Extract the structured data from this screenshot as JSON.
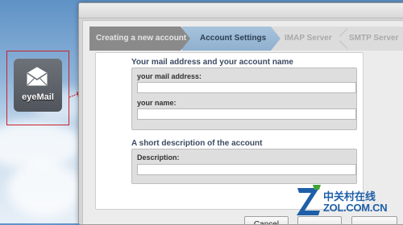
{
  "desktop": {
    "app_icon_label": "eyeMail"
  },
  "wizard": {
    "steps": [
      {
        "label": "Creating a new account",
        "state": "done"
      },
      {
        "label": "Account Settings",
        "state": "active"
      },
      {
        "label": "IMAP Server",
        "state": "pending"
      },
      {
        "label": "SMTP Server",
        "state": "pending"
      }
    ]
  },
  "form": {
    "section1_title": "Your mail address and your account name",
    "mail_address_label": "your mail address:",
    "mail_address_value": "",
    "name_label": "your name:",
    "name_value": "",
    "section2_title": "A short description of the account",
    "description_label": "Description:",
    "description_value": ""
  },
  "buttons": {
    "cancel": "Cancel"
  },
  "watermark": {
    "cn": "中关村在线",
    "en": "ZOL.COM.CN"
  },
  "colors": {
    "active_step": "#9bbad6",
    "done_step": "#8a8a8a",
    "icon_frame": "#c8222e",
    "watermark": "#1f5fa8"
  }
}
